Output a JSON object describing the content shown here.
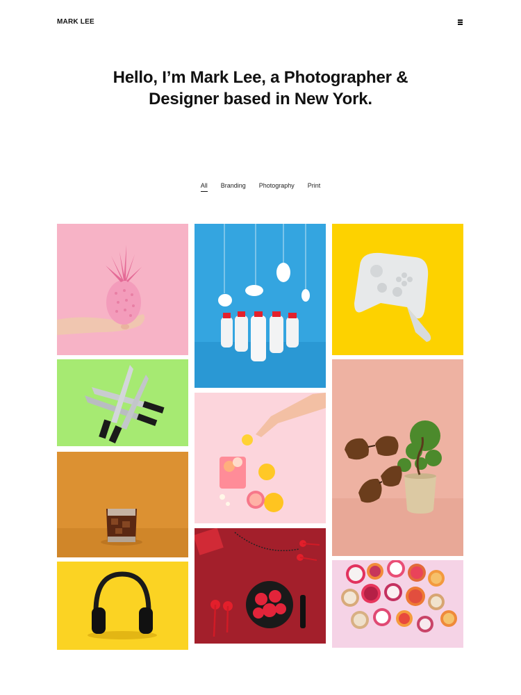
{
  "header": {
    "logo": "MARK LEE",
    "menu_icon": "hamburger-menu-icon"
  },
  "hero": {
    "headline": "Hello, I’m Mark Lee, a Photographer & Designer based in New York."
  },
  "filters": {
    "items": [
      "All",
      "Branding",
      "Photography",
      "Print"
    ],
    "active": "All"
  },
  "gallery": {
    "items": [
      {
        "subject": "pink-pineapple-in-hand",
        "background": "#f7b3c6"
      },
      {
        "subject": "crossed-kitchen-knives",
        "background": "#a6ea72"
      },
      {
        "subject": "iced-drink-glass",
        "background": "#dc9132"
      },
      {
        "subject": "black-headphones",
        "background": "#fbd323"
      },
      {
        "subject": "milk-bottles-with-clouds",
        "background": "#34a5e0"
      },
      {
        "subject": "pink-lemonade-with-citrus",
        "background": "#fcd5dc"
      },
      {
        "subject": "red-strawberries-flatlay",
        "background": "#a31f2b"
      },
      {
        "subject": "white-game-controller",
        "background": "#fdd200"
      },
      {
        "subject": "sunglasses-and-bonsai",
        "background": "#eeb2a2"
      },
      {
        "subject": "sliced-fruit-flatlay",
        "background": "#f5d3e6"
      }
    ]
  }
}
